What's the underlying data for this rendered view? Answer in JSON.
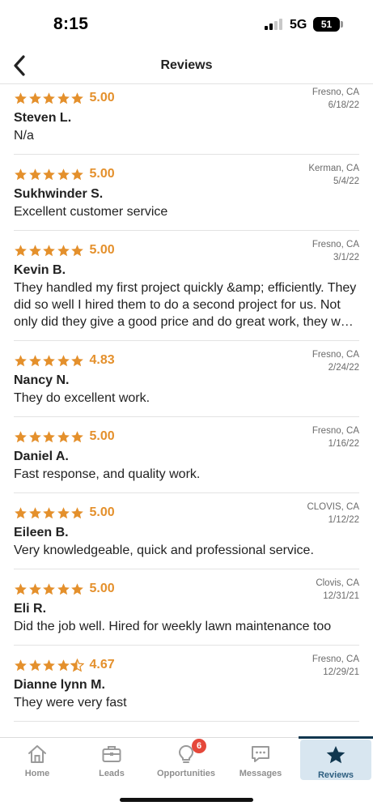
{
  "status_bar": {
    "time": "8:15",
    "network": "5G",
    "battery": "51",
    "signal_bars_active": 2,
    "signal_bars_total": 4
  },
  "header": {
    "title": "Reviews",
    "back_icon": "chevron-left-icon"
  },
  "colors": {
    "star": "#e4902c",
    "active_tab_bg": "#d8e6f0",
    "active_tab_text": "#2e5f80",
    "badge": "#e5483a"
  },
  "reviews": [
    {
      "rating": "5.00",
      "stars": 5,
      "location": "Fresno, CA",
      "date": "6/18/22",
      "name": "Steven L.",
      "text": "N/a"
    },
    {
      "rating": "5.00",
      "stars": 5,
      "location": "Kerman, CA",
      "date": "5/4/22",
      "name": "Sukhwinder S.",
      "text": "Excellent customer service"
    },
    {
      "rating": "5.00",
      "stars": 5,
      "location": "Fresno, CA",
      "date": "3/1/22",
      "name": "Kevin B.",
      "text": "They handled my first project quickly &amp; efficiently. They did so well I hired them to do a second project for us. Not only did they give a good price and do great work, they were friendly too."
    },
    {
      "rating": "4.83",
      "stars": 5,
      "location": "Fresno, CA",
      "date": "2/24/22",
      "name": "Nancy N.",
      "text": "They do excellent work."
    },
    {
      "rating": "5.00",
      "stars": 5,
      "location": "Fresno, CA",
      "date": "1/16/22",
      "name": "Daniel A.",
      "text": "Fast response, and quality work."
    },
    {
      "rating": "5.00",
      "stars": 5,
      "location": "CLOVIS, CA",
      "date": "1/12/22",
      "name": "Eileen B.",
      "text": "Very knowledgeable, quick and professional service."
    },
    {
      "rating": "5.00",
      "stars": 5,
      "location": "Clovis, CA",
      "date": "12/31/21",
      "name": "Eli R.",
      "text": "Did the job well. Hired for weekly lawn maintenance too"
    },
    {
      "rating": "4.67",
      "stars": 4.5,
      "location": "Fresno, CA",
      "date": "12/29/21",
      "name": "Dianne lynn M.",
      "text": "They were very fast"
    }
  ],
  "tabs": [
    {
      "label": "Home",
      "icon": "home-icon",
      "active": false
    },
    {
      "label": "Leads",
      "icon": "briefcase-icon",
      "active": false
    },
    {
      "label": "Opportunities",
      "icon": "lightbulb-icon",
      "active": false,
      "badge": "6"
    },
    {
      "label": "Messages",
      "icon": "chat-icon",
      "active": false
    },
    {
      "label": "Reviews",
      "icon": "star-icon",
      "active": true
    }
  ]
}
